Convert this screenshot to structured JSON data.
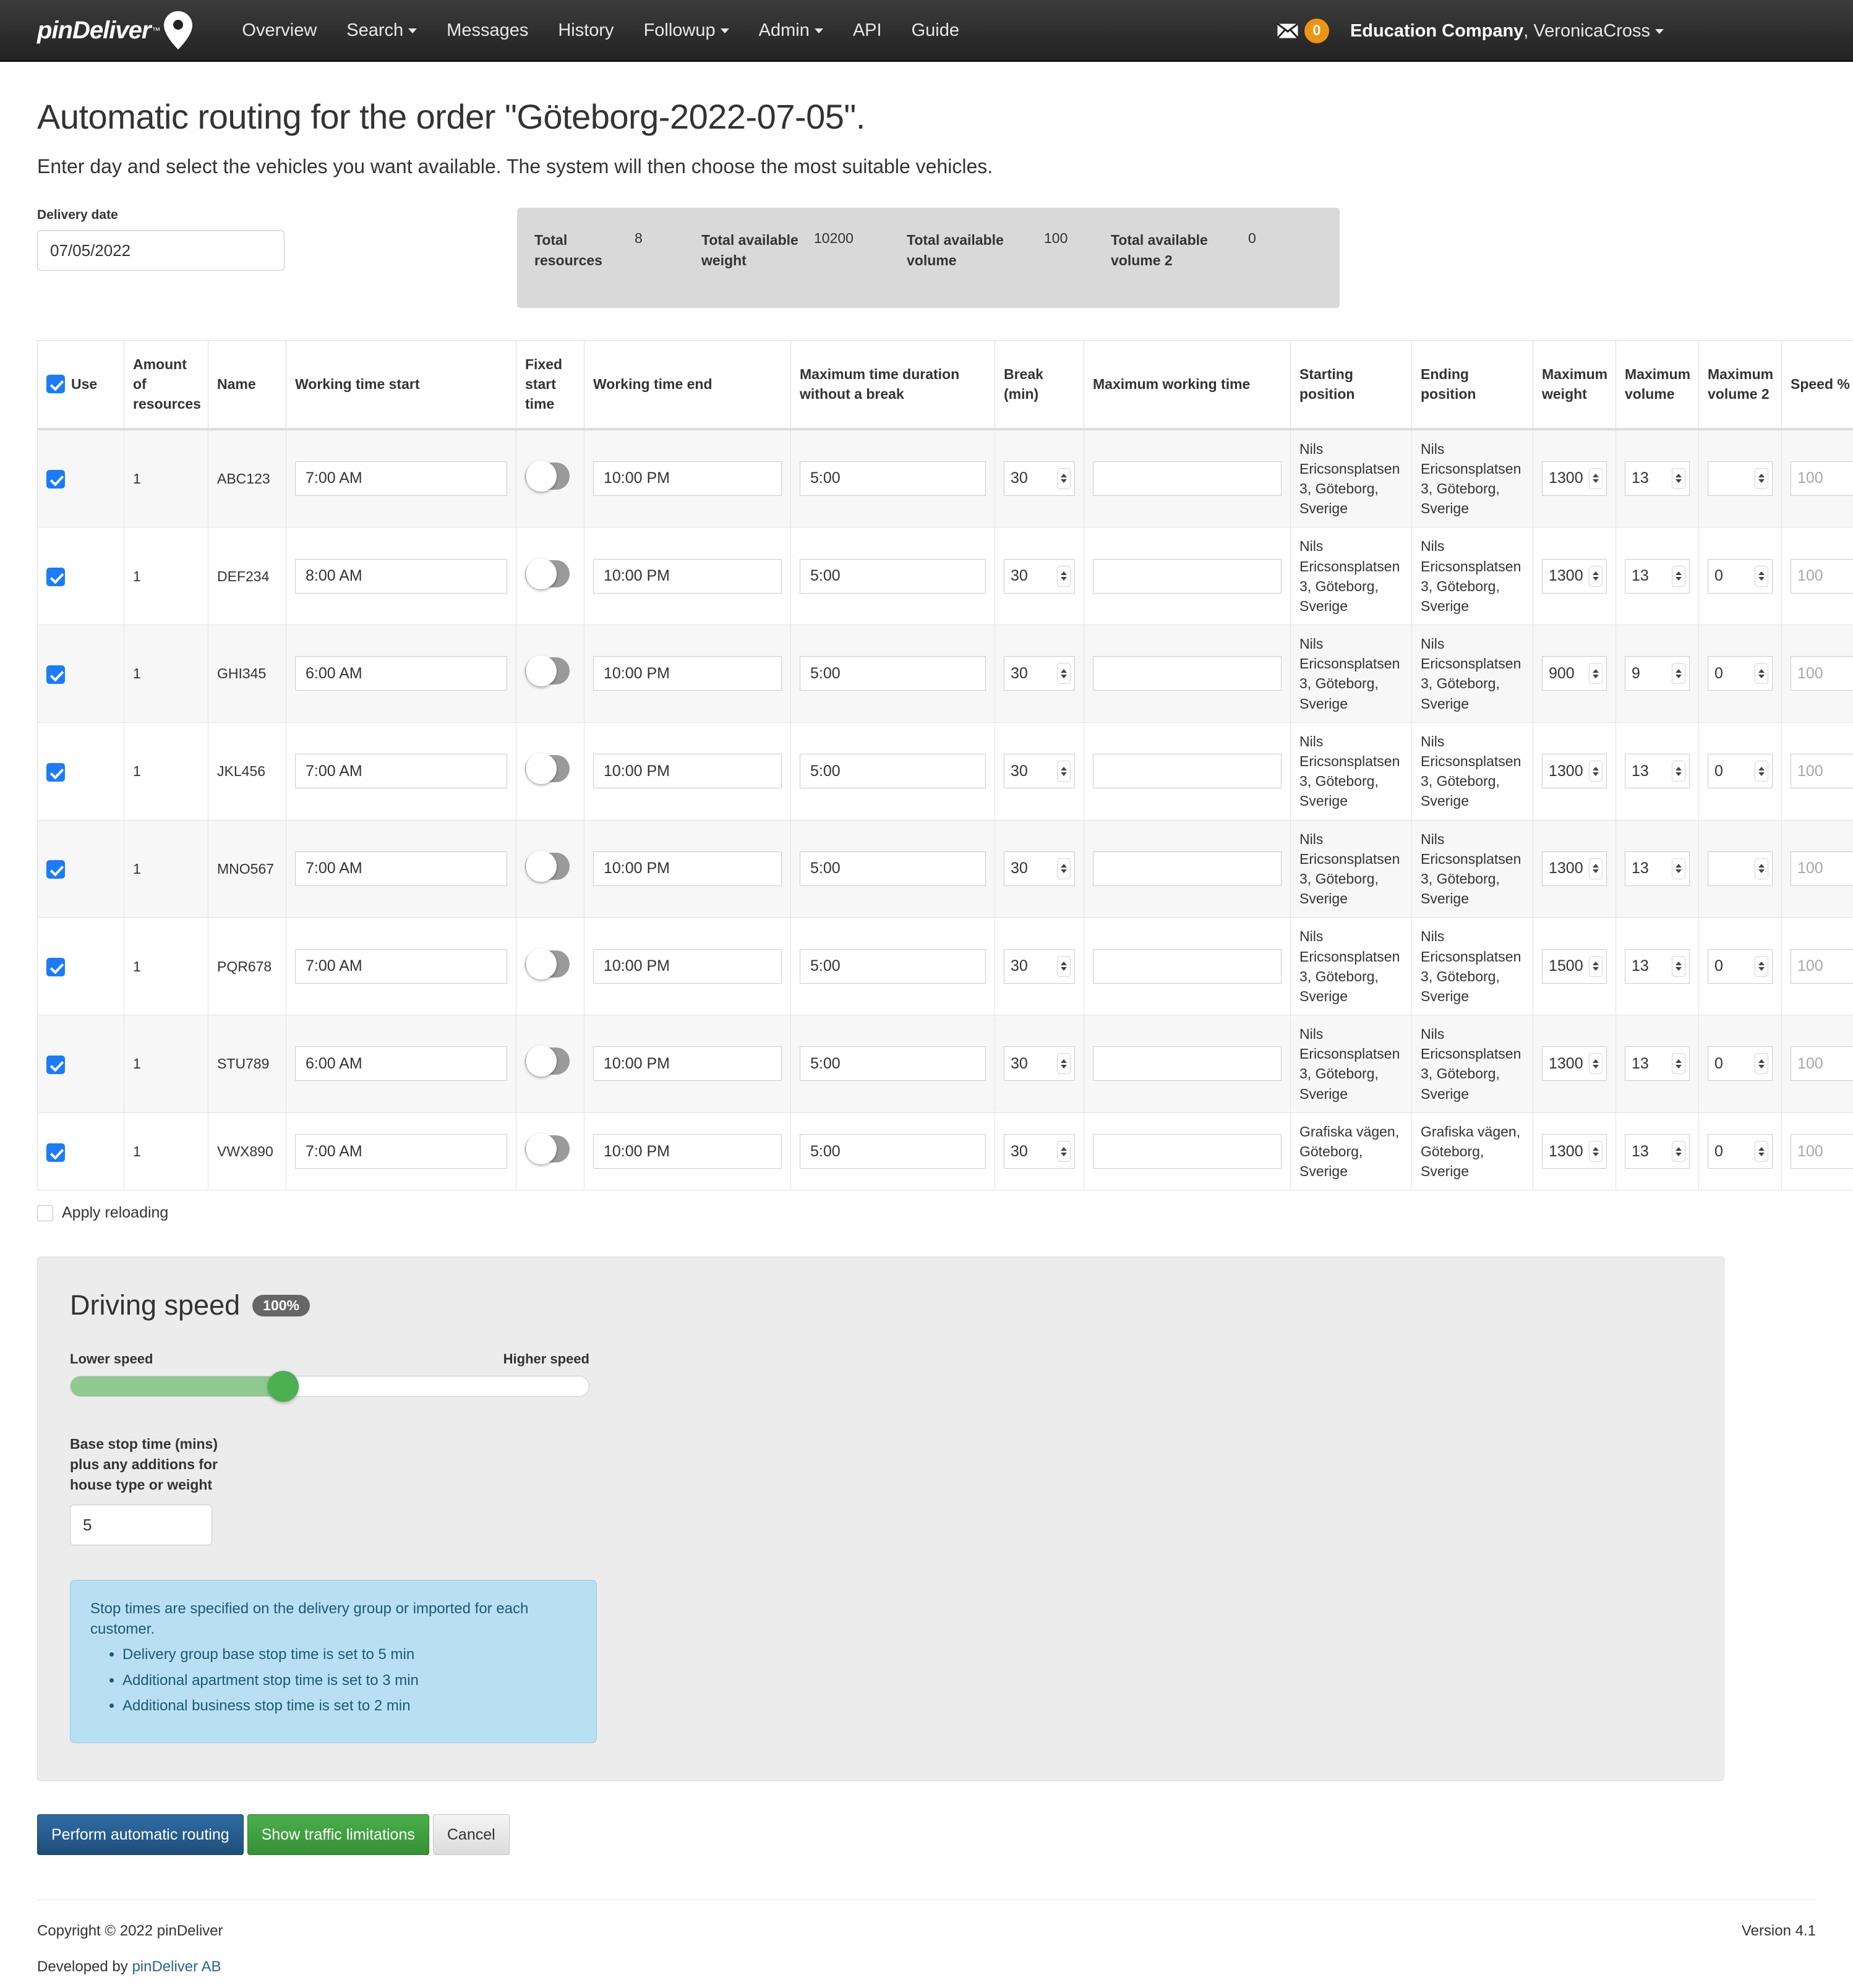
{
  "navbar": {
    "brand": "pinDeliver",
    "brand_tm": "™",
    "links": [
      {
        "label": "Overview",
        "caret": false
      },
      {
        "label": "Search",
        "caret": true
      },
      {
        "label": "Messages",
        "caret": false
      },
      {
        "label": "History",
        "caret": false
      },
      {
        "label": "Followup",
        "caret": true
      },
      {
        "label": "Admin",
        "caret": true
      },
      {
        "label": "API",
        "caret": false
      },
      {
        "label": "Guide",
        "caret": false
      }
    ],
    "mail_badge": "0",
    "company": "Education Company",
    "user": ", VeronicaCross"
  },
  "header": {
    "title": "Automatic routing for the order \"Göteborg-2022-07-05\".",
    "subtitle": "Enter day and select the vehicles you want available. The system will then choose the most suitable vehicles."
  },
  "delivery_date": {
    "label": "Delivery date",
    "value": "07/05/2022"
  },
  "summary": [
    {
      "name": "Total resources",
      "value": "8"
    },
    {
      "name": "Total available weight",
      "value": "10200"
    },
    {
      "name": "Total available volume",
      "value": "100"
    },
    {
      "name": "Total available volume 2",
      "value": "0"
    }
  ],
  "table": {
    "headers": {
      "use": "Use",
      "amount": "Amount of resources",
      "name": "Name",
      "work_start": "Working time start",
      "fixed_start": "Fixed start time",
      "work_end": "Working time end",
      "max_duration": "Maximum time duration without a break",
      "break": "Break (min)",
      "max_working": "Maximum working time",
      "start_pos": "Starting position",
      "end_pos": "Ending position",
      "max_weight": "Maximum weight",
      "max_volume": "Maximum volume",
      "max_volume2": "Maximum volume 2",
      "speed": "Speed %"
    },
    "speed_placeholder": "100",
    "rows": [
      {
        "use": true,
        "amount": "1",
        "name": "ABC123",
        "work_start": "7:00 AM",
        "fixed_start": false,
        "work_end": "10:00 PM",
        "max_duration": "5:00",
        "break": "30",
        "max_working": "",
        "start_pos": "Nils Ericsonsplatsen 3, Göteborg, Sverige",
        "end_pos": "Nils Ericsonsplatsen 3, Göteborg, Sverige",
        "max_weight": "1300",
        "max_volume": "13",
        "max_volume2": "",
        "speed": ""
      },
      {
        "use": true,
        "amount": "1",
        "name": "DEF234",
        "work_start": "8:00 AM",
        "fixed_start": false,
        "work_end": "10:00 PM",
        "max_duration": "5:00",
        "break": "30",
        "max_working": "",
        "start_pos": "Nils Ericsonsplatsen 3, Göteborg, Sverige",
        "end_pos": "Nils Ericsonsplatsen 3, Göteborg, Sverige",
        "max_weight": "1300",
        "max_volume": "13",
        "max_volume2": "0",
        "speed": ""
      },
      {
        "use": true,
        "amount": "1",
        "name": "GHI345",
        "work_start": "6:00 AM",
        "fixed_start": false,
        "work_end": "10:00 PM",
        "max_duration": "5:00",
        "break": "30",
        "max_working": "",
        "start_pos": "Nils Ericsonsplatsen 3, Göteborg, Sverige",
        "end_pos": "Nils Ericsonsplatsen 3, Göteborg, Sverige",
        "max_weight": "900",
        "max_volume": "9",
        "max_volume2": "0",
        "speed": ""
      },
      {
        "use": true,
        "amount": "1",
        "name": "JKL456",
        "work_start": "7:00 AM",
        "fixed_start": false,
        "work_end": "10:00 PM",
        "max_duration": "5:00",
        "break": "30",
        "max_working": "",
        "start_pos": "Nils Ericsonsplatsen 3, Göteborg, Sverige",
        "end_pos": "Nils Ericsonsplatsen 3, Göteborg, Sverige",
        "max_weight": "1300",
        "max_volume": "13",
        "max_volume2": "0",
        "speed": ""
      },
      {
        "use": true,
        "amount": "1",
        "name": "MNO567",
        "work_start": "7:00 AM",
        "fixed_start": false,
        "work_end": "10:00 PM",
        "max_duration": "5:00",
        "break": "30",
        "max_working": "",
        "start_pos": "Nils Ericsonsplatsen 3, Göteborg, Sverige",
        "end_pos": "Nils Ericsonsplatsen 3, Göteborg, Sverige",
        "max_weight": "1300",
        "max_volume": "13",
        "max_volume2": "",
        "speed": ""
      },
      {
        "use": true,
        "amount": "1",
        "name": "PQR678",
        "work_start": "7:00 AM",
        "fixed_start": false,
        "work_end": "10:00 PM",
        "max_duration": "5:00",
        "break": "30",
        "max_working": "",
        "start_pos": "Nils Ericsonsplatsen 3, Göteborg, Sverige",
        "end_pos": "Nils Ericsonsplatsen 3, Göteborg, Sverige",
        "max_weight": "1500",
        "max_volume": "13",
        "max_volume2": "0",
        "speed": ""
      },
      {
        "use": true,
        "amount": "1",
        "name": "STU789",
        "work_start": "6:00 AM",
        "fixed_start": false,
        "work_end": "10:00 PM",
        "max_duration": "5:00",
        "break": "30",
        "max_working": "",
        "start_pos": "Nils Ericsonsplatsen 3, Göteborg, Sverige",
        "end_pos": "Nils Ericsonsplatsen 3, Göteborg, Sverige",
        "max_weight": "1300",
        "max_volume": "13",
        "max_volume2": "0",
        "speed": ""
      },
      {
        "use": true,
        "amount": "1",
        "name": "VWX890",
        "work_start": "7:00 AM",
        "fixed_start": false,
        "work_end": "10:00 PM",
        "max_duration": "5:00",
        "break": "30",
        "max_working": "",
        "start_pos": "Grafiska vägen, Göteborg, Sverige",
        "end_pos": "Grafiska vägen, Göteborg, Sverige",
        "max_weight": "1300",
        "max_volume": "13",
        "max_volume2": "0",
        "speed": ""
      }
    ]
  },
  "apply_reloading": {
    "label": "Apply reloading",
    "checked": false
  },
  "driving_speed": {
    "title": "Driving speed",
    "percent": "100%",
    "lower_label": "Lower speed",
    "higher_label": "Higher speed",
    "base_stop_label": "Base stop time (mins) plus any additions for house type or weight",
    "base_stop_value": "5",
    "info_text": "Stop times are specified on the delivery group or imported for each customer.",
    "info_items": [
      "Delivery group base stop time is set to 5 min",
      "Additional apartment stop time is set to 3 min",
      "Additional business stop time is set to 2 min"
    ]
  },
  "buttons": {
    "primary": "Perform automatic routing",
    "success": "Show traffic limitations",
    "cancel": "Cancel"
  },
  "footer": {
    "copyright": "Copyright © 2022 pinDeliver",
    "version": "Version 4.1",
    "developed_prefix": "Developed by ",
    "developed_link": "pinDeliver AB"
  },
  "colors": {
    "accent_blue": "#1a7bfb",
    "brand_orange": "#ef9314",
    "primary_btn": "#2e6da4",
    "success_btn": "#4cae4c",
    "slider_green": "#4caf50",
    "info_bg": "#b9e0f2"
  }
}
